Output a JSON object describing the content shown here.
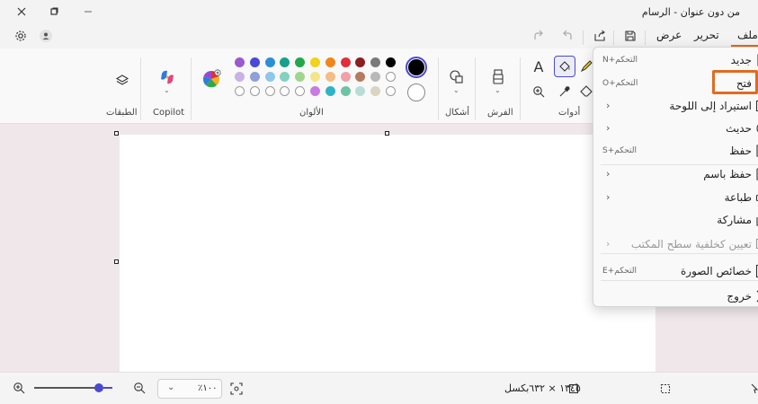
{
  "titlebar": {
    "title": "من دون عنوان - الرسام",
    "controls": [
      "close",
      "restore",
      "minimize"
    ]
  },
  "menubar": {
    "tabs": [
      {
        "label": "ملف",
        "name": "tab-file"
      },
      {
        "label": "تحرير",
        "name": "tab-edit"
      },
      {
        "label": "عرض",
        "name": "tab-view"
      }
    ]
  },
  "ribbon": {
    "groups": {
      "tools": "أدوات",
      "brushes": "الفرش",
      "shapes": "أشكال",
      "colors": "الألوان",
      "copilot": "Copilot",
      "layers": "الطبقات"
    },
    "palette": {
      "row1": [
        "#9b59d0",
        "#4a4ad6",
        "#2b8fd8",
        "#1aa08a",
        "#22a84a",
        "#f2d21a",
        "#f0861c",
        "#e02f3a",
        "#8a1f22",
        "#7a7a7a",
        "#000000"
      ],
      "row2": [
        "#c9b2e6",
        "#8fa0d8",
        "#8ec7ea",
        "#85d1c0",
        "#9fd68e",
        "#f4e589",
        "#f4bd84",
        "#efa1a7",
        "#b67a5e",
        "#b8b8b8",
        "#ffffff"
      ],
      "row3": [
        "empty",
        "empty",
        "empty",
        "empty",
        "empty",
        "#c77de0",
        "#2fb3c9",
        "#6cc4a4",
        "#b8ddd6",
        "#d9d5c2",
        "empty"
      ],
      "primary": "#000000",
      "secondary": "#ffffff"
    }
  },
  "file_menu": {
    "items": [
      {
        "label": "جديد",
        "shortcut": "التحكم+N",
        "icon": "new-icon",
        "chevron": false,
        "disabled": false
      },
      {
        "label": "فتح",
        "shortcut": "التحكم+O",
        "icon": "folder-icon",
        "chevron": false,
        "disabled": false
      },
      {
        "label": "استيراد إلى اللوحة",
        "shortcut": "",
        "icon": "import-icon",
        "chevron": true,
        "disabled": false
      },
      {
        "label": "حديث",
        "shortcut": "",
        "icon": "clock-icon",
        "chevron": true,
        "disabled": false
      },
      {
        "label": "حفظ",
        "shortcut": "التحكم+S",
        "icon": "save-icon",
        "chevron": false,
        "disabled": false
      },
      {
        "label": "حفظ باسم",
        "shortcut": "",
        "icon": "save-as-icon",
        "chevron": true,
        "disabled": false
      },
      {
        "label": "طباعة",
        "shortcut": "",
        "icon": "print-icon",
        "chevron": true,
        "disabled": false
      },
      {
        "label": "مشاركة",
        "shortcut": "",
        "icon": "share-icon",
        "chevron": false,
        "disabled": false
      },
      {
        "label": "تعيين كخلفية سطح المكتب",
        "shortcut": "",
        "icon": "wallpaper-icon",
        "chevron": true,
        "disabled": true
      },
      {
        "label": "خصائص الصورة",
        "shortcut": "التحكم+E",
        "icon": "image-properties-icon",
        "chevron": false,
        "disabled": false
      },
      {
        "label": "خروج",
        "shortcut": "",
        "icon": "close-icon",
        "chevron": false,
        "disabled": false
      }
    ]
  },
  "statusbar": {
    "canvas_size": "١٣٤٥ × ٦٣٢بكسل",
    "zoom": "١٠٠٪",
    "zoom_level": 0.72
  },
  "colors": {
    "highlight": "#e06b1f",
    "accent": "#4a4ad0"
  }
}
